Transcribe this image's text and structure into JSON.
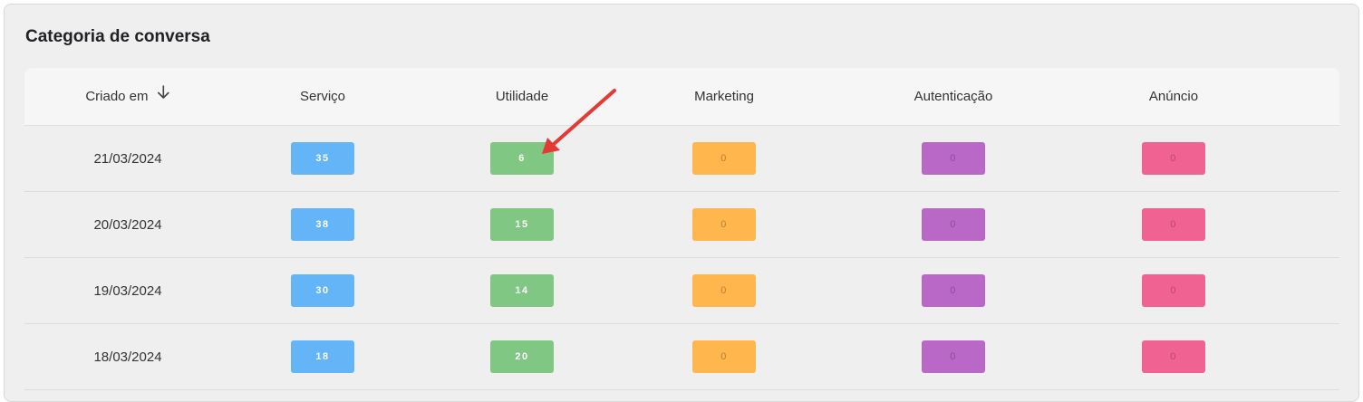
{
  "card": {
    "title": "Categoria de conversa"
  },
  "table": {
    "columns": [
      {
        "label": "Criado em",
        "sortable": true,
        "sort": "desc"
      },
      {
        "label": "Serviço"
      },
      {
        "label": "Utilidade"
      },
      {
        "label": "Marketing"
      },
      {
        "label": "Autenticação"
      },
      {
        "label": "Anúncio"
      }
    ],
    "rows": [
      {
        "date": "21/03/2024",
        "servico": "35",
        "utilidade": "6",
        "marketing": "0",
        "autenticacao": "0",
        "anuncio": "0"
      },
      {
        "date": "20/03/2024",
        "servico": "38",
        "utilidade": "15",
        "marketing": "0",
        "autenticacao": "0",
        "anuncio": "0"
      },
      {
        "date": "19/03/2024",
        "servico": "30",
        "utilidade": "14",
        "marketing": "0",
        "autenticacao": "0",
        "anuncio": "0"
      },
      {
        "date": "18/03/2024",
        "servico": "18",
        "utilidade": "20",
        "marketing": "0",
        "autenticacao": "0",
        "anuncio": "0"
      }
    ]
  },
  "colors": {
    "servico": "#63b5f7",
    "utilidade": "#81c784",
    "marketing": "#ffb74d",
    "autenticacao": "#ba68c8",
    "anuncio": "#f06292",
    "annotation_arrow": "#e53935"
  },
  "icons": {
    "sort": "arrow-down-icon",
    "annotation": "red-arrow-annotation"
  }
}
